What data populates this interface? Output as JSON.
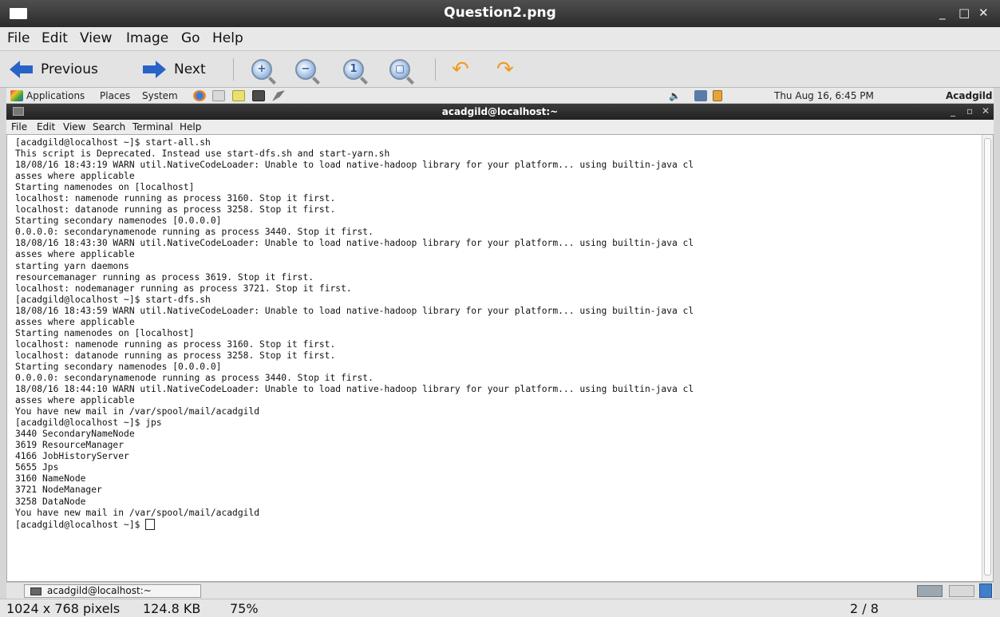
{
  "viewer": {
    "title": "Question2.png",
    "menu": [
      "File",
      "Edit",
      "View",
      "Image",
      "Go",
      "Help"
    ],
    "toolbar": {
      "previous_label": "Previous",
      "next_label": "Next"
    },
    "status": {
      "dimensions": "1024 x 768 pixels",
      "size": "124.8 KB",
      "zoom": "75%",
      "page": "2 / 8"
    }
  },
  "desktop_panel": {
    "menus": [
      "Applications",
      "Places",
      "System"
    ],
    "datetime": "Thu Aug 16,  6:45 PM",
    "user": "Acadgild"
  },
  "terminal": {
    "title": "acadgild@localhost:~",
    "menu": [
      "File",
      "Edit",
      "View",
      "Search",
      "Terminal",
      "Help"
    ],
    "output": "[acadgild@localhost ~]$ start-all.sh\nThis script is Deprecated. Instead use start-dfs.sh and start-yarn.sh\n18/08/16 18:43:19 WARN util.NativeCodeLoader: Unable to load native-hadoop library for your platform... using builtin-java cl\nasses where applicable\nStarting namenodes on [localhost]\nlocalhost: namenode running as process 3160. Stop it first.\nlocalhost: datanode running as process 3258. Stop it first.\nStarting secondary namenodes [0.0.0.0]\n0.0.0.0: secondarynamenode running as process 3440. Stop it first.\n18/08/16 18:43:30 WARN util.NativeCodeLoader: Unable to load native-hadoop library for your platform... using builtin-java cl\nasses where applicable\nstarting yarn daemons\nresourcemanager running as process 3619. Stop it first.\nlocalhost: nodemanager running as process 3721. Stop it first.\n[acadgild@localhost ~]$ start-dfs.sh\n18/08/16 18:43:59 WARN util.NativeCodeLoader: Unable to load native-hadoop library for your platform... using builtin-java cl\nasses where applicable\nStarting namenodes on [localhost]\nlocalhost: namenode running as process 3160. Stop it first.\nlocalhost: datanode running as process 3258. Stop it first.\nStarting secondary namenodes [0.0.0.0]\n0.0.0.0: secondarynamenode running as process 3440. Stop it first.\n18/08/16 18:44:10 WARN util.NativeCodeLoader: Unable to load native-hadoop library for your platform... using builtin-java cl\nasses where applicable\nYou have new mail in /var/spool/mail/acadgild\n[acadgild@localhost ~]$ jps\n3440 SecondaryNameNode\n3619 ResourceManager\n4166 JobHistoryServer\n5655 Jps\n3160 NameNode\n3721 NodeManager\n3258 DataNode\nYou have new mail in /var/spool/mail/acadgild",
    "prompt": "[acadgild@localhost ~]$ "
  },
  "taskbar": {
    "window_label": "acadgild@localhost:~"
  },
  "colors": {
    "arrow_blue": "#2a63c8",
    "rotate_orange": "#f09a1e",
    "titlebar_dark": "#2b2b2b"
  }
}
